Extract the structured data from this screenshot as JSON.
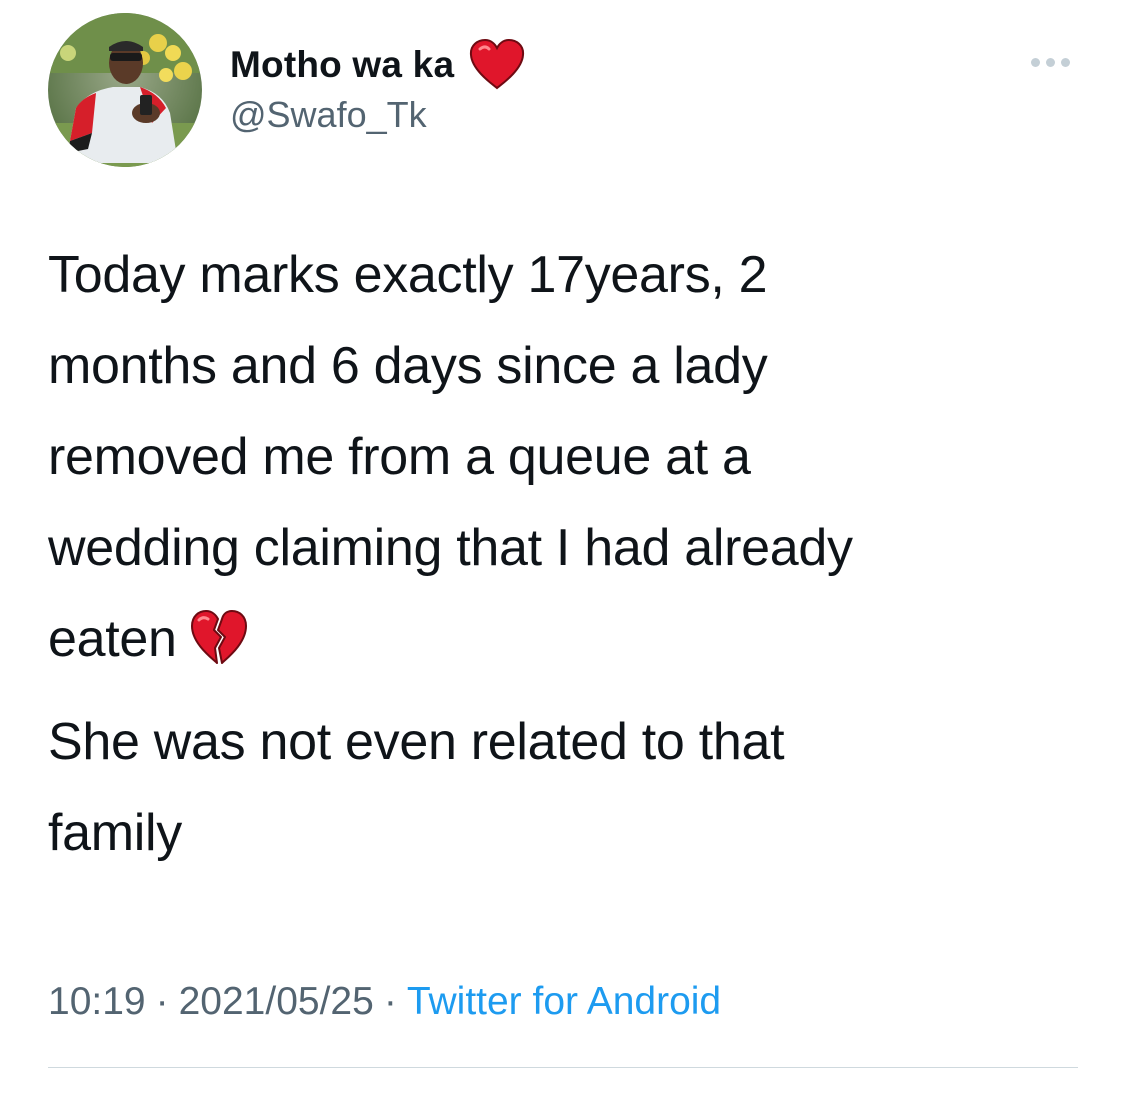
{
  "author": {
    "display_name": "Motho wa ka",
    "name_emoji_icon": "red-heart-icon",
    "handle": "@Swafo_Tk",
    "avatar_icon": "profile-photo-avatar"
  },
  "tweet": {
    "paragraph_1": "Today marks exactly 17years, 2\nmonths and 6 days since a lady\nremoved me from a queue at a\nwedding claiming that I had already\neaten",
    "paragraph_1_emoji_icon": "broken-heart-icon",
    "paragraph_2": "She was not even related to that\nfamily"
  },
  "meta": {
    "time": "10:19",
    "separator": "·",
    "date": "2021/05/25",
    "source": "Twitter for Android"
  },
  "colors": {
    "text_primary": "#0f1419",
    "text_secondary": "#536471",
    "link": "#1d9bf0",
    "divider": "#cfd9de",
    "heart_red": "#e0162b"
  },
  "more_options_icon": "more-horizontal-icon"
}
